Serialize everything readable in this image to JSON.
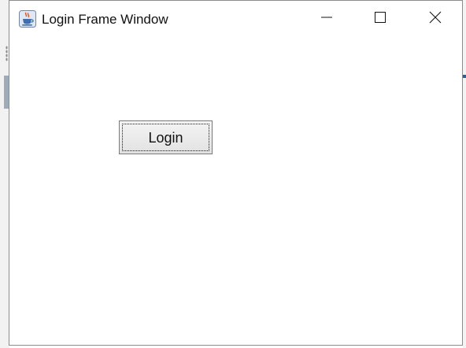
{
  "window": {
    "title": "Login Frame Window",
    "icon": "java-cup-icon",
    "controls": {
      "minimize": "minimize-icon",
      "maximize": "maximize-icon",
      "close": "close-icon"
    }
  },
  "content": {
    "login_label": "Login"
  },
  "colors": {
    "window_background": "#ffffff",
    "button_border": "#7a7a7a",
    "button_face": "#ececec",
    "text": "#111111"
  }
}
